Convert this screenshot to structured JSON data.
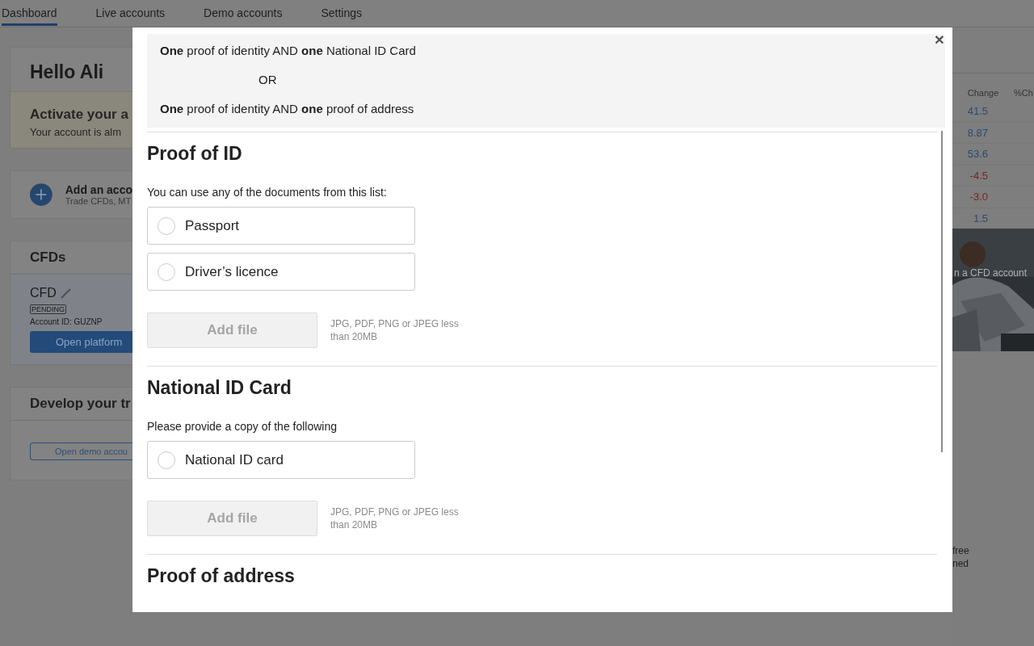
{
  "nav": {
    "tabs": [
      {
        "label": "Dashboard",
        "selected": true
      },
      {
        "label": "Live accounts",
        "selected": false
      },
      {
        "label": "Demo accounts",
        "selected": false
      },
      {
        "label": "Settings",
        "selected": false
      }
    ]
  },
  "dashboard": {
    "greeting": "Hello Ali",
    "activation": {
      "title": "Activate your a",
      "text": "Your account is alm"
    },
    "add_account": {
      "title": "Add an acco",
      "subtitle": "Trade CFDs, MT"
    },
    "cfds": {
      "title": "CFDs",
      "account": {
        "name": "CFD",
        "status": "PENDING",
        "account_id": "Account ID: GUZNP",
        "button": "Open platform"
      }
    },
    "develop": {
      "title": "Develop your tr",
      "button": "Open demo accou"
    }
  },
  "market_table": {
    "columns": [
      "Change",
      "%Ch"
    ],
    "rows": [
      {
        "change": "41.5",
        "color": "#2a4a72"
      },
      {
        "change": "8.87",
        "color": "#2a4a72"
      },
      {
        "change": "53.6",
        "color": "#2a4a72"
      },
      {
        "change": "-4.5",
        "color": "#7c2424"
      },
      {
        "change": "-3.0",
        "color": "#7c2424"
      },
      {
        "change": "1.5",
        "color": "#2a4a72"
      }
    ]
  },
  "promo": {
    "kind": "picture",
    "text": "n a CFD account"
  },
  "side_note": {
    "lines": [
      "free",
      "ned"
    ]
  },
  "modal": {
    "close": "×",
    "requirements": [
      {
        "kind": "rule",
        "text": "**One** proof of identity AND **one** National ID Card"
      },
      {
        "kind": "separator",
        "text": "OR"
      },
      {
        "kind": "rule",
        "text": "**One** proof of identity AND **one** proof of address"
      }
    ],
    "sections": [
      {
        "title": "Proof of ID",
        "instruction": "You can use any of the documents from this list:",
        "options": [
          {
            "label": "Passport",
            "selected": false
          },
          {
            "label": "Driver’s licence",
            "selected": false
          }
        ],
        "upload": {
          "button": "Add file",
          "disabled": true,
          "hint": "JPG, PDF, PNG or JPEG less than 20MB"
        }
      },
      {
        "title": "National ID Card",
        "instruction": "Please provide a copy of the following",
        "options": [
          {
            "label": "National ID card",
            "selected": false
          }
        ],
        "upload": {
          "button": "Add file",
          "disabled": true,
          "hint": "JPG, PDF, PNG or JPEG less than 20MB"
        }
      },
      {
        "title": "Proof of address"
      }
    ]
  }
}
